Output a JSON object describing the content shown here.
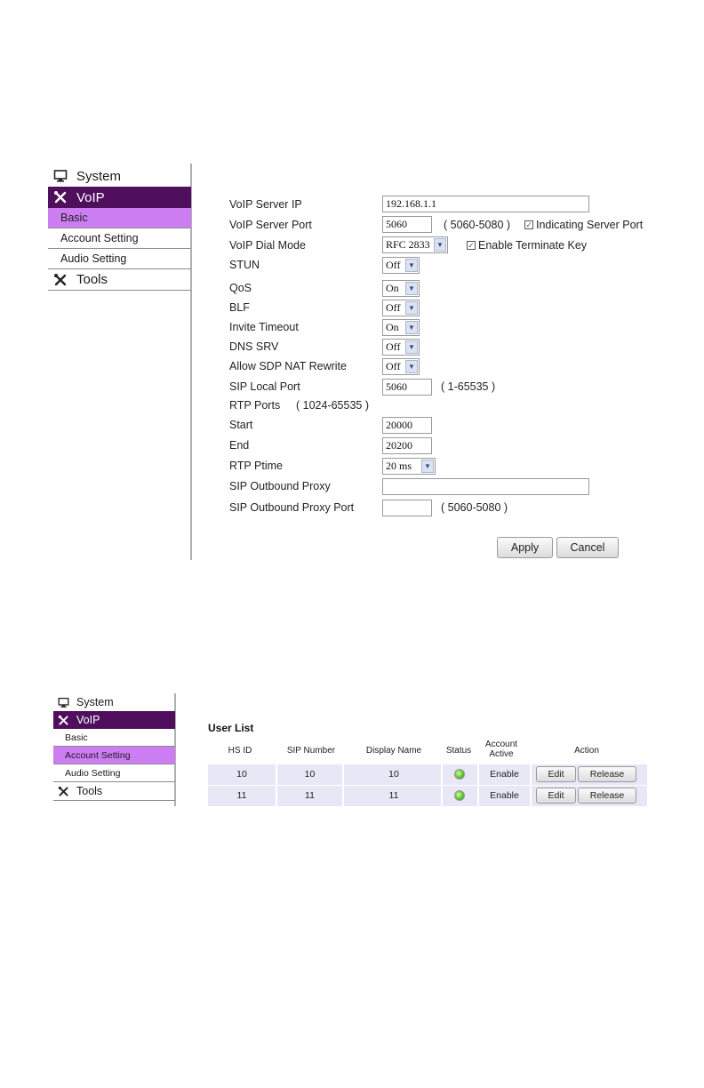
{
  "figure1": {
    "sidebar": {
      "system": "System",
      "voip": "VoIP",
      "items": [
        "Basic",
        "Account Setting",
        "Audio Setting"
      ],
      "tools": "Tools"
    },
    "form": {
      "voip_server_ip": {
        "label": "VoIP Server IP",
        "value": "192.168.1.1"
      },
      "voip_server_port": {
        "label": "VoIP Server Port",
        "value": "5060",
        "hint": "( 5060-5080 )",
        "checkbox": "Indicating Server Port"
      },
      "voip_dial_mode": {
        "label": "VoIP Dial Mode",
        "value": "RFC 2833",
        "checkbox": "Enable Terminate Key"
      },
      "stun": {
        "label": "STUN",
        "value": "Off"
      },
      "qos": {
        "label": "QoS",
        "value": "On"
      },
      "blf": {
        "label": "BLF",
        "value": "Off"
      },
      "invite_timeout": {
        "label": "Invite Timeout",
        "value": "On"
      },
      "dns_srv": {
        "label": "DNS SRV",
        "value": "Off"
      },
      "allow_sdp_nat": {
        "label": "Allow SDP NAT Rewrite",
        "value": "Off"
      },
      "sip_local_port": {
        "label": "SIP Local Port",
        "value": "5060",
        "hint": "( 1-65535 )"
      },
      "rtp_ports": {
        "label": "RTP Ports",
        "hint": "( 1024-65535 )"
      },
      "start": {
        "label": "Start",
        "value": "20000"
      },
      "end": {
        "label": "End",
        "value": "20200"
      },
      "rtp_ptime": {
        "label": "RTP Ptime",
        "value": "20 ms"
      },
      "sip_outbound_proxy": {
        "label": "SIP Outbound Proxy",
        "value": ""
      },
      "sip_outbound_proxy_port": {
        "label": "SIP Outbound Proxy Port",
        "value": "",
        "hint": "( 5060-5080 )"
      }
    },
    "buttons": {
      "apply": "Apply",
      "cancel": "Cancel"
    }
  },
  "figure2": {
    "sidebar": {
      "system": "System",
      "voip": "VoIP",
      "items": [
        "Basic",
        "Account Setting",
        "Audio Setting"
      ],
      "tools": "Tools"
    },
    "user_list": {
      "title": "User List",
      "columns": [
        "HS ID",
        "SIP Number",
        "Display Name",
        "Status",
        "Account Active",
        "Action"
      ],
      "column_active_line1": "Account",
      "column_active_line2": "Active",
      "rows": [
        {
          "hs_id": "10",
          "sip_number": "10",
          "display_name": "10",
          "account_active": "Enable",
          "edit": "Edit",
          "release": "Release"
        },
        {
          "hs_id": "11",
          "sip_number": "11",
          "display_name": "11",
          "account_active": "Enable",
          "edit": "Edit",
          "release": "Release"
        }
      ]
    }
  },
  "colors": {
    "voip_header": "#4f0f5c",
    "active_item": "#cc7df2",
    "row_bg": "#e8e7f6",
    "status_led": "#5cc231"
  }
}
